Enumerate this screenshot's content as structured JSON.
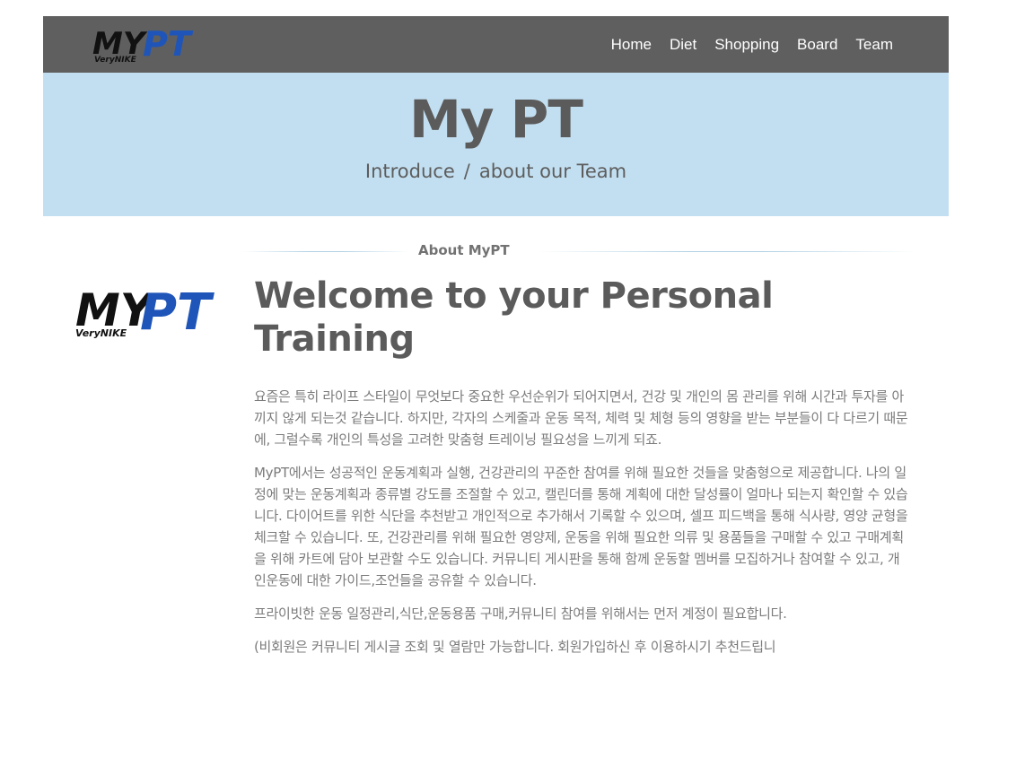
{
  "nav": {
    "logo_text_my": "MY",
    "logo_text_pt": "PT",
    "logo_tagline": "VeryNIKE",
    "links": [
      "Home",
      "Diet",
      "Shopping",
      "Board",
      "Team"
    ]
  },
  "hero": {
    "title": "My PT",
    "subtitle_part1": "Introduce",
    "subtitle_separator": "/",
    "subtitle_part2": "about our Team"
  },
  "section": {
    "label": "About MyPT",
    "welcome_title": "Welcome to your Personal Training",
    "paragraphs": [
      "요즘은 특히 라이프 스타일이 무엇보다 중요한 우선순위가 되어지면서, 건강 및 개인의 몸 관리를 위해 시간과 투자를 아끼지 않게 되는것 같습니다. 하지만, 각자의 스케줄과 운동 목적, 체력 및 체형 등의 영향을 받는 부분들이 다 다르기 때문에, 그럴수록 개인의 특성을 고려한 맞춤형 트레이닝 필요성을 느끼게 되죠.",
      "MyPT에서는 성공적인 운동계획과 실행, 건강관리의 꾸준한 참여를 위해 필요한 것들을 맞춤형으로 제공합니다. 나의 일정에 맞는 운동계획과 종류별 강도를 조절할 수 있고, 캘린더를 통해 계획에 대한 달성률이 얼마나 되는지 확인할 수 있습니다. 다이어트를 위한 식단을 추천받고 개인적으로 추가해서 기록할 수 있으며, 셀프 피드백을 통해 식사량, 영양 균형을 체크할 수 있습니다. 또, 건강관리를 위해 필요한 영양제, 운동을 위해 필요한 의류 및 용품들을 구매할 수 있고 구매계획을 위해 카트에 담아 보관할 수도 있습니다. 커뮤니티 게시판을 통해 함께 운동할 멤버를 모집하거나 참여할 수 있고, 개인운동에 대한 가이드,조언들을 공유할 수 있습니다.",
      "프라이빗한 운동 일정관리,식단,운동용품 구매,커뮤니티 참여를 위해서는 먼저 계정이 필요합니다.",
      "(비회원은 커뮤니티 게시글 조회 및 열람만 가능합니다. 회원가입하신 후 이용하시기 추천드립니"
    ]
  },
  "colors": {
    "navbar_bg": "#5f5f5f",
    "hero_bg": "#c2dff1",
    "logo_black": "#111111",
    "logo_blue": "#1f55b8"
  }
}
